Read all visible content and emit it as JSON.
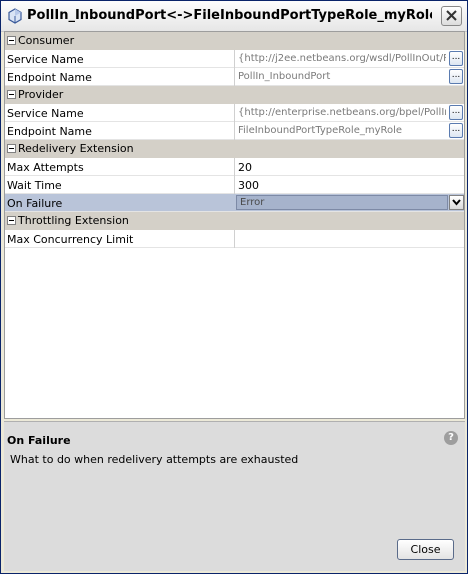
{
  "window": {
    "title": "PollIn_InboundPort<->FileInboundPortTypeRole_myRole - Prop...",
    "close_glyph": "✕"
  },
  "sheet": {
    "consumer": {
      "label": "Consumer",
      "service_name_label": "Service Name",
      "service_name_value": "{http://j2ee.netbeans.org/wsdl/PollInOut/P...",
      "endpoint_name_label": "Endpoint Name",
      "endpoint_name_value": "PollIn_InboundPort"
    },
    "provider": {
      "label": "Provider",
      "service_name_label": "Service Name",
      "service_name_value": "{http://enterprise.netbeans.org/bpel/PollIn...",
      "endpoint_name_label": "Endpoint Name",
      "endpoint_name_value": "FileInboundPortTypeRole_myRole"
    },
    "redelivery": {
      "label": "Redelivery Extension",
      "max_attempts_label": "Max Attempts",
      "max_attempts_value": "20",
      "wait_time_label": "Wait Time",
      "wait_time_value": "300",
      "on_failure_label": "On Failure",
      "on_failure_value": "Error"
    },
    "throttling": {
      "label": "Throttling Extension",
      "max_concurrency_label": "Max Concurrency Limit",
      "max_concurrency_value": ""
    },
    "ellipsis": "..."
  },
  "description": {
    "heading": "On Failure",
    "text": "What to do when redelivery attempts are exhausted",
    "help_glyph": "?"
  },
  "buttons": {
    "close_label": "Close"
  }
}
